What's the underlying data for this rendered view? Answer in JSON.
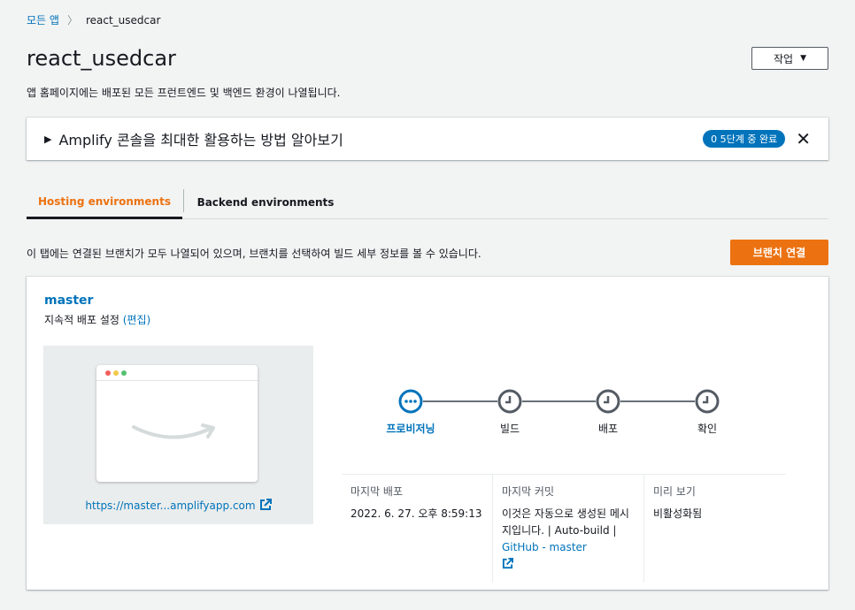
{
  "breadcrumb": {
    "all_apps": "모든 앱",
    "separator": ">",
    "current": "react_usedcar"
  },
  "page": {
    "title": "react_usedcar",
    "description": "앱 홈페이지에는 배포된 모든 프런트엔드 및 백엔드 환경이 나열됩니다.",
    "actions_label": "작업"
  },
  "banner": {
    "title": "Amplify 콘솔을 최대한 활용하는 방법 알아보기",
    "progress": "0 5단계 중 완료"
  },
  "tabs": {
    "hosting": "Hosting environments",
    "backend": "Backend environments"
  },
  "hosting": {
    "description": "이 탭에는 연결된 브랜치가 모두 나열되어 있으며, 브랜치를 선택하여 빌드 세부 정보를 볼 수 있습니다.",
    "connect_label": "브랜치 연결"
  },
  "branch": {
    "name": "master",
    "cd_text": "지속적 배포 설정",
    "cd_edit": "(편집)",
    "preview_url": "https://master...amplifyapp.com",
    "steps": [
      {
        "label": "프로비저닝",
        "status": "in-progress"
      },
      {
        "label": "빌드",
        "status": "pending"
      },
      {
        "label": "배포",
        "status": "pending"
      },
      {
        "label": "확인",
        "status": "pending"
      }
    ],
    "last_deploy_label": "마지막 배포",
    "last_deploy_value": "2022. 6. 27. 오후 8:59:13",
    "last_commit_label": "마지막 커밋",
    "last_commit_text": "이것은 자동으로 생성된 메시지입니다. | Auto-build |",
    "last_commit_link": "GitHub - master",
    "preview_label": "미리 보기",
    "preview_value": "비활성화됨"
  },
  "colors": {
    "accent": "#ec7211",
    "link": "#0073bb",
    "badge": "#0073bb"
  }
}
